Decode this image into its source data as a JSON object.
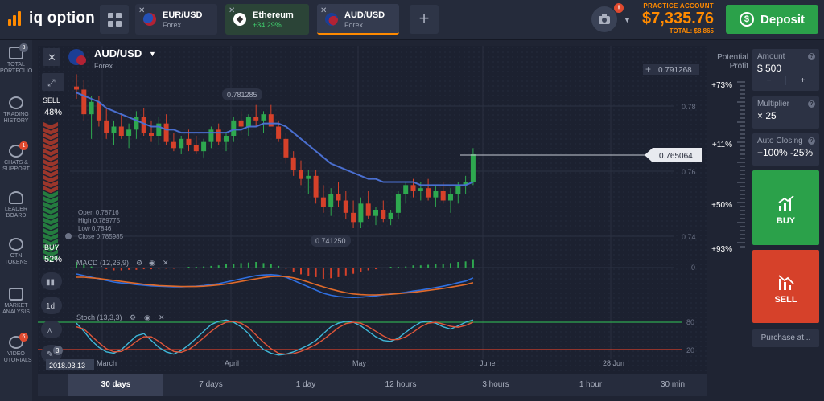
{
  "brand": {
    "name": "iq option"
  },
  "tabs": [
    {
      "name": "EUR/USD",
      "sub": "Forex",
      "active": false
    },
    {
      "name": "Ethereum",
      "sub": "+34.29%",
      "active": false
    },
    {
      "name": "AUD/USD",
      "sub": "Forex",
      "active": true
    }
  ],
  "account": {
    "label": "PRACTICE ACCOUNT",
    "balance": "$7,335.76",
    "total": "TOTAL: $8,865",
    "notif_count": "!"
  },
  "deposit": {
    "label": "Deposit",
    "icon": "dollar-circle-icon"
  },
  "nav": [
    {
      "label": "TOTAL PORTFOLIO",
      "badge": "3",
      "icon": "briefcase-icon"
    },
    {
      "label": "TRADING HISTORY",
      "badge": "",
      "icon": "history-icon"
    },
    {
      "label": "CHATS & SUPPORT",
      "badge": "1",
      "icon": "chat-icon"
    },
    {
      "label": "LEADER BOARD",
      "badge": "",
      "icon": "trophy-icon"
    },
    {
      "label": "OTN TOKENS",
      "badge": "",
      "icon": "token-icon"
    },
    {
      "label": "MARKET ANALYSIS",
      "badge": "",
      "icon": "analysis-icon"
    },
    {
      "label": "VIDEO TUTORIALS",
      "badge": "6",
      "icon": "play-icon"
    }
  ],
  "asset": {
    "name": "AUD/USD",
    "type": "Forex"
  },
  "sentiment": {
    "sell_label": "SELL",
    "sell_pct": "48%",
    "buy_label": "BUY",
    "buy_pct": "52%"
  },
  "ohlc": {
    "open": "Open   0.78716",
    "high": "High   0.789775",
    "low": "Low    0.7846",
    "close": "Close  0.785985"
  },
  "price_labels": {
    "top": "0.791268",
    "current": "0.765064",
    "max_callout": "0.781285",
    "min_callout": "0.741250"
  },
  "price_axis": [
    "0.78",
    "0.76",
    "0.74"
  ],
  "indicators": {
    "macd": "MACD (12,26,9)",
    "macd_zero": "0",
    "stoch": "Stoch (13,3,3)",
    "stoch_80": "80",
    "stoch_20": "20"
  },
  "x_axis": [
    "March",
    "April",
    "May",
    "June",
    "28 Jun"
  ],
  "date_label": "2018.03.13",
  "tool_badge": "3",
  "timeframes": [
    "30 days",
    "7 days",
    "1 day",
    "12 hours",
    "3 hours",
    "1 hour",
    "30 min"
  ],
  "potential_profit": {
    "title": "Potential Profit",
    "levels": [
      "+73%",
      "+11%",
      "+50%",
      "+93%"
    ]
  },
  "trade": {
    "amount_title": "Amount",
    "amount_value": "$ 500",
    "multiplier_title": "Multiplier",
    "multiplier_value": "× 25",
    "auto_title": "Auto Closing",
    "auto_value": "+100%  -25%",
    "minus": "−",
    "plus": "+",
    "buy": "BUY",
    "sell": "SELL",
    "purchase": "Purchase at..."
  },
  "chart_data": {
    "type": "candlestick",
    "period": "1 day",
    "ylim": [
      0.735,
      0.795
    ],
    "candles": [
      [
        0.787,
        0.791,
        0.783,
        0.786
      ],
      [
        0.786,
        0.789,
        0.776,
        0.778
      ],
      [
        0.778,
        0.784,
        0.77,
        0.782
      ],
      [
        0.782,
        0.784,
        0.774,
        0.776
      ],
      [
        0.776,
        0.78,
        0.77,
        0.772
      ],
      [
        0.772,
        0.776,
        0.768,
        0.774
      ],
      [
        0.774,
        0.778,
        0.77,
        0.771
      ],
      [
        0.771,
        0.775,
        0.767,
        0.773
      ],
      [
        0.773,
        0.779,
        0.77,
        0.777
      ],
      [
        0.777,
        0.78,
        0.771,
        0.772
      ],
      [
        0.772,
        0.776,
        0.769,
        0.771
      ],
      [
        0.771,
        0.777,
        0.768,
        0.775
      ],
      [
        0.775,
        0.778,
        0.768,
        0.769
      ],
      [
        0.769,
        0.772,
        0.766,
        0.767
      ],
      [
        0.767,
        0.771,
        0.765,
        0.77
      ],
      [
        0.77,
        0.773,
        0.766,
        0.768
      ],
      [
        0.768,
        0.771,
        0.765,
        0.766
      ],
      [
        0.766,
        0.77,
        0.764,
        0.769
      ],
      [
        0.769,
        0.774,
        0.767,
        0.773
      ],
      [
        0.773,
        0.775,
        0.768,
        0.769
      ],
      [
        0.769,
        0.772,
        0.766,
        0.771
      ],
      [
        0.771,
        0.777,
        0.769,
        0.776
      ],
      [
        0.776,
        0.779,
        0.772,
        0.774
      ],
      [
        0.774,
        0.778,
        0.771,
        0.777
      ],
      [
        0.777,
        0.781,
        0.774,
        0.776
      ],
      [
        0.776,
        0.779,
        0.772,
        0.778
      ],
      [
        0.778,
        0.781,
        0.775,
        0.774
      ],
      [
        0.774,
        0.776,
        0.769,
        0.77
      ],
      [
        0.77,
        0.772,
        0.762,
        0.764
      ],
      [
        0.764,
        0.766,
        0.758,
        0.76
      ],
      [
        0.76,
        0.763,
        0.755,
        0.757
      ],
      [
        0.757,
        0.76,
        0.752,
        0.758
      ],
      [
        0.758,
        0.76,
        0.749,
        0.751
      ],
      [
        0.751,
        0.755,
        0.746,
        0.748
      ],
      [
        0.748,
        0.754,
        0.745,
        0.752
      ],
      [
        0.752,
        0.756,
        0.748,
        0.75
      ],
      [
        0.75,
        0.753,
        0.744,
        0.746
      ],
      [
        0.746,
        0.75,
        0.741,
        0.743
      ],
      [
        0.743,
        0.751,
        0.741,
        0.749
      ],
      [
        0.749,
        0.753,
        0.744,
        0.745
      ],
      [
        0.745,
        0.748,
        0.742,
        0.747
      ],
      [
        0.747,
        0.75,
        0.743,
        0.744
      ],
      [
        0.744,
        0.747,
        0.742,
        0.746
      ],
      [
        0.746,
        0.753,
        0.744,
        0.752
      ],
      [
        0.752,
        0.756,
        0.749,
        0.755
      ],
      [
        0.755,
        0.757,
        0.751,
        0.753
      ],
      [
        0.753,
        0.756,
        0.75,
        0.754
      ],
      [
        0.754,
        0.757,
        0.75,
        0.751
      ],
      [
        0.751,
        0.755,
        0.748,
        0.753
      ],
      [
        0.753,
        0.756,
        0.749,
        0.75
      ],
      [
        0.75,
        0.754,
        0.746,
        0.752
      ],
      [
        0.752,
        0.756,
        0.749,
        0.755
      ],
      [
        0.755,
        0.758,
        0.752,
        0.756
      ],
      [
        0.756,
        0.767,
        0.755,
        0.765
      ]
    ],
    "moving_average": [
      0.785,
      0.784,
      0.783,
      0.782,
      0.78,
      0.779,
      0.778,
      0.777,
      0.776,
      0.775,
      0.774,
      0.774,
      0.773,
      0.773,
      0.772,
      0.772,
      0.772,
      0.772,
      0.772,
      0.772,
      0.772,
      0.773,
      0.773,
      0.774,
      0.774,
      0.775,
      0.775,
      0.775,
      0.774,
      0.772,
      0.77,
      0.768,
      0.766,
      0.764,
      0.762,
      0.761,
      0.76,
      0.759,
      0.758,
      0.757,
      0.757,
      0.756,
      0.756,
      0.756,
      0.756,
      0.756,
      0.755,
      0.755,
      0.755,
      0.755,
      0.755,
      0.755,
      0.755,
      0.756
    ],
    "macd": {
      "line": [
        3,
        2.5,
        2,
        1.5,
        1,
        0.5,
        0.2,
        0,
        -0.3,
        -0.5,
        -0.7,
        -0.8,
        -0.9,
        -1,
        -1,
        -0.9,
        -0.8,
        -0.6,
        -0.3,
        0,
        0.5,
        1,
        1.5,
        2,
        2.5,
        2.7,
        2.8,
        2.6,
        2,
        1,
        0,
        -1,
        -2,
        -3,
        -3.6,
        -4,
        -4.2,
        -4.3,
        -4.2,
        -4,
        -3.8,
        -3.5,
        -3.2,
        -3,
        -2.7,
        -2.3,
        -2,
        -1.6,
        -1.2,
        -0.8,
        -0.3,
        0.3,
        0.8,
        1.8
      ],
      "signal": [
        2,
        2,
        1.8,
        1.6,
        1.3,
        1,
        0.7,
        0.4,
        0.1,
        -0.2,
        -0.4,
        -0.6,
        -0.7,
        -0.8,
        -0.9,
        -0.9,
        -0.9,
        -0.8,
        -0.6,
        -0.4,
        -0.1,
        0.3,
        0.7,
        1.1,
        1.5,
        1.9,
        2.2,
        2.3,
        2.2,
        1.8,
        1.2,
        0.5,
        -0.3,
        -1,
        -1.7,
        -2.3,
        -2.8,
        -3.2,
        -3.4,
        -3.5,
        -3.5,
        -3.4,
        -3.3,
        -3.1,
        -2.9,
        -2.7,
        -2.4,
        -2.1,
        -1.8,
        -1.5,
        -1.1,
        -0.7,
        -0.3,
        0.3
      ]
    },
    "stoch": {
      "k": [
        78,
        60,
        40,
        25,
        15,
        12,
        20,
        35,
        50,
        55,
        40,
        25,
        15,
        10,
        18,
        30,
        45,
        60,
        75,
        82,
        85,
        80,
        70,
        55,
        35,
        20,
        12,
        8,
        10,
        15,
        22,
        30,
        40,
        55,
        70,
        78,
        82,
        80,
        72,
        60,
        48,
        40,
        38,
        45,
        58,
        70,
        80,
        82,
        78,
        70,
        65,
        72,
        80,
        85
      ],
      "d": [
        70,
        65,
        50,
        35,
        22,
        15,
        16,
        25,
        38,
        48,
        48,
        38,
        26,
        16,
        14,
        20,
        32,
        46,
        60,
        72,
        80,
        82,
        78,
        68,
        52,
        36,
        22,
        12,
        10,
        11,
        16,
        23,
        31,
        42,
        55,
        68,
        77,
        80,
        78,
        70,
        60,
        50,
        42,
        42,
        48,
        58,
        70,
        78,
        80,
        76,
        71,
        69,
        73,
        80
      ]
    }
  }
}
